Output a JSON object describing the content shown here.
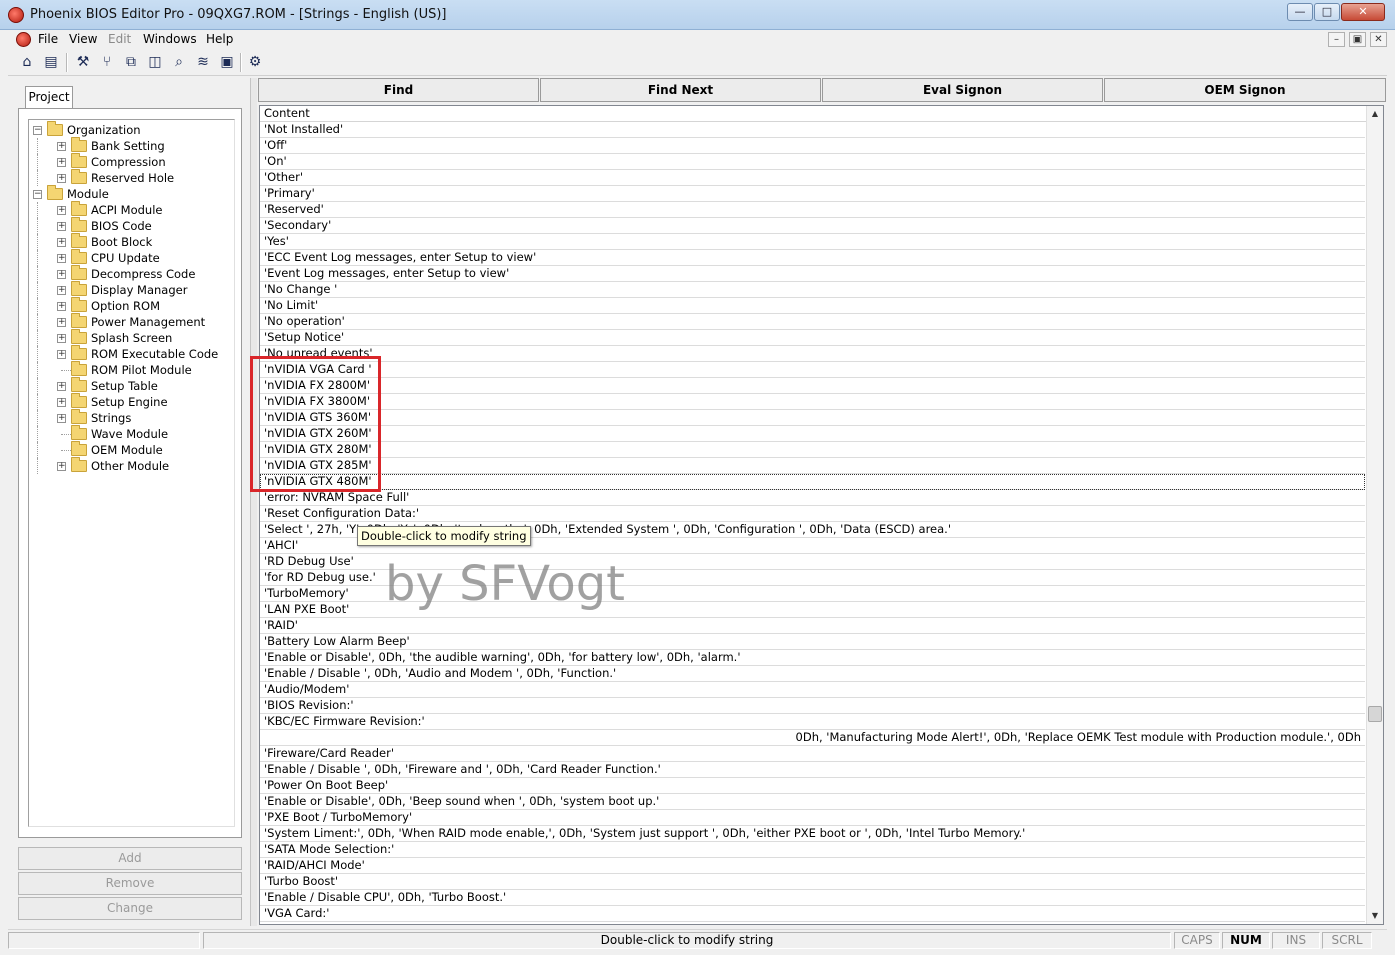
{
  "window": {
    "title": "Phoenix BIOS Editor Pro - 09QXG7.ROM - [Strings - English (US)]",
    "min_label": "—",
    "max_label": "□",
    "close_label": "✕"
  },
  "menu": {
    "items": [
      "File",
      "View",
      "Edit",
      "Windows",
      "Help"
    ],
    "mdi_min": "–",
    "mdi_restore": "▣",
    "mdi_close": "✕"
  },
  "toolbar": {
    "icons": [
      "open-icon",
      "save-icon",
      "build-icon",
      "tree-icon",
      "copy-icon",
      "split-icon",
      "search-icon",
      "waveform-icon",
      "monitor-icon",
      "settings-icon"
    ],
    "glyphs": [
      "⌂",
      "▤",
      "⚒",
      "⑂",
      "⧉",
      "◫",
      "⌕",
      "≋",
      "▣",
      "⚙"
    ]
  },
  "left": {
    "tab_label": "Project",
    "tree": [
      {
        "label": "Organization",
        "level": 0,
        "expander": "−"
      },
      {
        "label": "Bank Setting",
        "level": 1,
        "expander": "+"
      },
      {
        "label": "Compression",
        "level": 1,
        "expander": "+"
      },
      {
        "label": "Reserved Hole",
        "level": 1,
        "expander": "+"
      },
      {
        "label": "Module",
        "level": 0,
        "expander": "−"
      },
      {
        "label": "ACPI Module",
        "level": 1,
        "expander": "+"
      },
      {
        "label": "BIOS Code",
        "level": 1,
        "expander": "+"
      },
      {
        "label": "Boot Block",
        "level": 1,
        "expander": "+"
      },
      {
        "label": "CPU Update",
        "level": 1,
        "expander": "+"
      },
      {
        "label": "Decompress Code",
        "level": 1,
        "expander": "+"
      },
      {
        "label": "Display Manager",
        "level": 1,
        "expander": "+"
      },
      {
        "label": "Option ROM",
        "level": 1,
        "expander": "+"
      },
      {
        "label": "Power Management",
        "level": 1,
        "expander": "+"
      },
      {
        "label": "Splash Screen",
        "level": 1,
        "expander": "+"
      },
      {
        "label": "ROM Executable Code",
        "level": 1,
        "expander": "+"
      },
      {
        "label": "ROM Pilot Module",
        "level": 1,
        "expander": ""
      },
      {
        "label": "Setup Table",
        "level": 1,
        "expander": "+"
      },
      {
        "label": "Setup Engine",
        "level": 1,
        "expander": "+"
      },
      {
        "label": "Strings",
        "level": 1,
        "expander": "+"
      },
      {
        "label": "Wave Module",
        "level": 1,
        "expander": ""
      },
      {
        "label": "OEM Module",
        "level": 1,
        "expander": ""
      },
      {
        "label": "Other Module",
        "level": 1,
        "expander": "+"
      }
    ],
    "buttons": {
      "add": "Add",
      "remove": "Remove",
      "change": "Change"
    }
  },
  "right": {
    "buttons": {
      "find": "Find",
      "find_next": "Find Next",
      "eval_signon": "Eval Signon",
      "oem_signon": "OEM Signon"
    },
    "column_header": "Content",
    "rows": [
      "'Not Installed'",
      "'Off'",
      "'On'",
      "'Other'",
      "'Primary'",
      "'Reserved'",
      "'Secondary'",
      "'Yes'",
      "'ECC Event Log messages, enter Setup to view'",
      "'Event Log messages, enter Setup to view'",
      "'No Change   '",
      "'No Limit'",
      "'No operation'",
      "'Setup Notice'",
      "'No unread events'",
      "'nVIDIA VGA Card '",
      "'nVIDIA FX 2800M'",
      "'nVIDIA FX 3800M'",
      "'nVIDIA GTS 360M'",
      "'nVIDIA GTX 260M'",
      "'nVIDIA GTX 280M'",
      "'nVIDIA GTX 285M'",
      "'nVIDIA GTX 480M'",
      "'error: NVRAM Space Full'",
      "'Reset Configuration Data:'",
      "'Select ', 27h, 'Y', 0Dh, 'Ye', 0Dh, 'to clear the', 0Dh, 'Extended System ', 0Dh, 'Configuration ', 0Dh, 'Data (ESCD) area.'",
      "'AHCI'",
      "'RD Debug Use'",
      "'for RD Debug use.'",
      "'TurboMemory'",
      "'LAN PXE Boot'",
      "'RAID'",
      "'Battery Low Alarm Beep'",
      "'Enable or Disable', 0Dh, 'the audible warning', 0Dh, 'for battery low', 0Dh, 'alarm.'",
      "'Enable / Disable ', 0Dh, 'Audio and Modem ', 0Dh, 'Function.'",
      "'Audio/Modem'",
      "'BIOS Revision:'",
      "'KBC/EC Firmware Revision:'",
      "0Dh, 'Manufacturing Mode Alert!', 0Dh, 'Replace OEMK Test module with Production module.', 0Dh",
      "'Fireware/Card Reader'",
      "'Enable / Disable ', 0Dh, 'Fireware and ', 0Dh, 'Card Reader Function.'",
      "'Power On Boot Beep'",
      "'Enable or Disable', 0Dh, 'Beep sound when ', 0Dh, 'system boot up.'",
      "'PXE Boot / TurboMemory'",
      "'System Liment:', 0Dh, 'When RAID mode enable,', 0Dh, 'System just support ', 0Dh, 'either PXE boot or ', 0Dh, 'Intel Turbo Memory.'",
      "'SATA Mode Selection:'",
      "'RAID/AHCI Mode'",
      "'Turbo Boost'",
      "'Enable / Disable CPU', 0Dh, 'Turbo Boost.'",
      "'VGA Card:'"
    ],
    "right_aligned_row_index": 38,
    "selected_row_index": 22,
    "tooltip": "Double-click to modify string",
    "watermark": "by SFVogt",
    "scroll_up": "▲",
    "scroll_down": "▼"
  },
  "status": {
    "message": "Double-click to modify string",
    "caps": "CAPS",
    "num": "NUM",
    "ins": "INS",
    "scrl": "SCRL"
  },
  "colors": {
    "highlight_box": "#d9262a",
    "tooltip_bg": "#ffffe1"
  }
}
